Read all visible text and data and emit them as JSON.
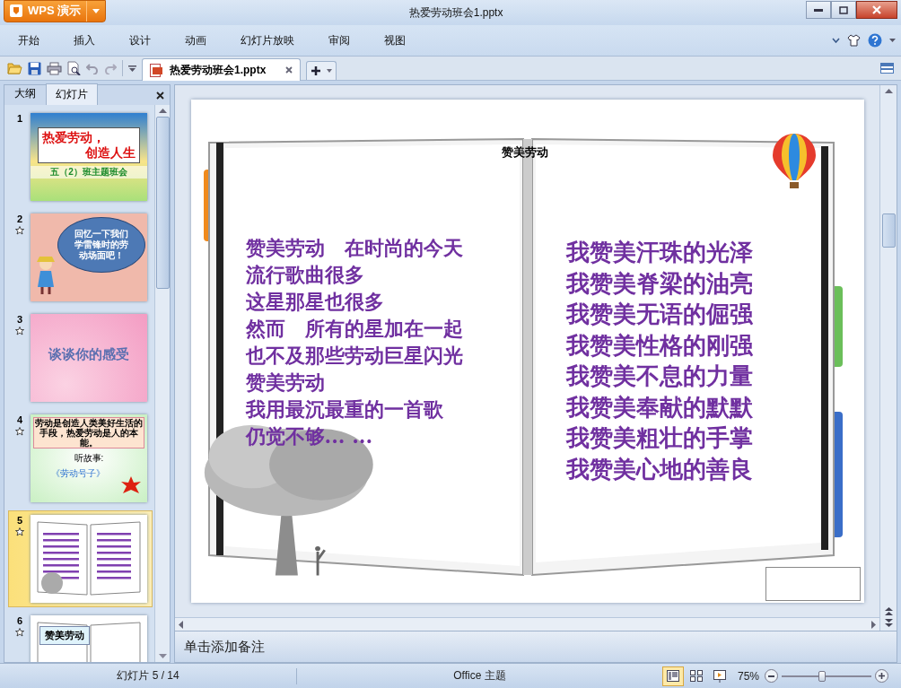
{
  "window": {
    "app_button": "WPS 演示",
    "title": "热爱劳动班会1.pptx"
  },
  "menu": [
    "开始",
    "插入",
    "设计",
    "动画",
    "幻灯片放映",
    "审阅",
    "视图"
  ],
  "document_tab": {
    "label": "热爱劳动班会1.pptx"
  },
  "panel": {
    "tabs": [
      {
        "label": "大纲",
        "selected": false
      },
      {
        "label": "幻灯片",
        "selected": true
      }
    ],
    "slides": [
      {
        "number": "1",
        "animated": false,
        "selected": false,
        "kind": "title",
        "texts": [
          "热爱劳动，",
          "创造人生",
          "五（2）班主题班会"
        ]
      },
      {
        "number": "2",
        "animated": true,
        "selected": false,
        "kind": "bubble",
        "texts": [
          "回忆一下我们学雷锋时的劳动场面吧！"
        ]
      },
      {
        "number": "3",
        "animated": true,
        "selected": false,
        "kind": "heading",
        "texts": [
          "谈谈你的感受"
        ]
      },
      {
        "number": "4",
        "animated": true,
        "selected": false,
        "kind": "story",
        "texts": [
          "劳动是创造人类美好生活的手段，热爱劳动是人的本能。",
          "听故事:",
          "《劳动号子》"
        ]
      },
      {
        "number": "5",
        "animated": true,
        "selected": true,
        "kind": "book"
      },
      {
        "number": "6",
        "animated": true,
        "selected": false,
        "kind": "label",
        "texts": [
          "赞美劳动"
        ]
      }
    ]
  },
  "slide": {
    "title": "赞美劳动",
    "left_lines": [
      "赞美劳动　在时尚的今天",
      "流行歌曲很多",
      "这星那星也很多",
      "然而　所有的星加在一起",
      "也不及那些劳动巨星闪光",
      "赞美劳动",
      "我用最沉最重的一首歌",
      "仍觉不够... ..."
    ],
    "right_lines": [
      "我赞美汗珠的光泽",
      "我赞美脊梁的油亮",
      "我赞美无语的倔强",
      "我赞美性格的刚强",
      "我赞美不息的力量",
      "我赞美奉献的默默",
      "我赞美粗壮的手掌",
      "我赞美心地的善良"
    ]
  },
  "notes": {
    "placeholder": "单击添加备注"
  },
  "status_bar": {
    "slide_position": "幻灯片 5 / 14",
    "theme": "Office 主题",
    "views": [
      {
        "kind": "normal",
        "selected": true
      },
      {
        "kind": "sorter",
        "selected": false
      },
      {
        "kind": "show",
        "selected": false
      }
    ],
    "zoom": "75%",
    "zoom_slider": {
      "level": 0.45
    }
  }
}
